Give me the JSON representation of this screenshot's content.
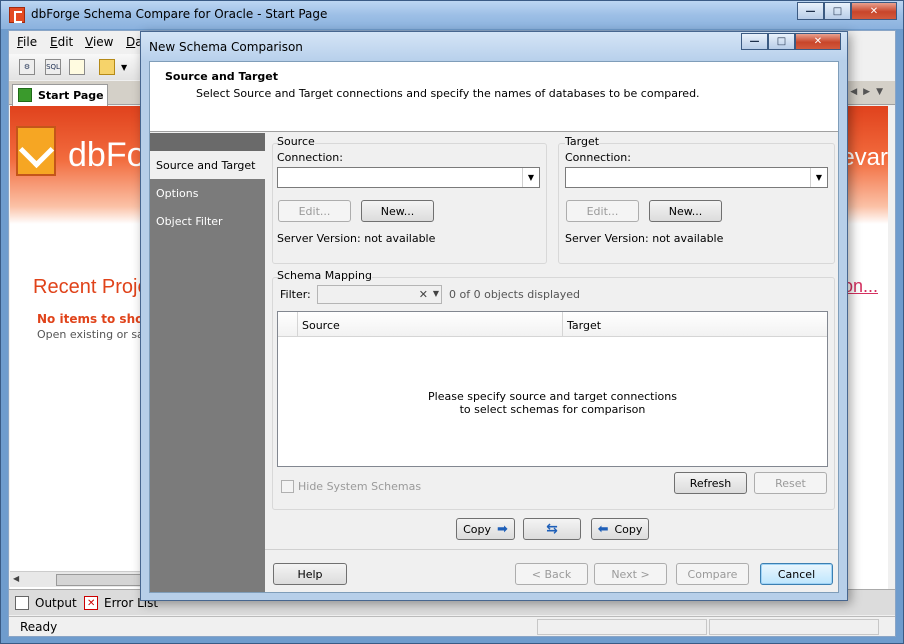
{
  "main_window": {
    "title": "dbForge Schema Compare for Oracle - Start Page",
    "menu": [
      {
        "label": "File",
        "hotkey": "F",
        "rest": "ile"
      },
      {
        "label": "Edit",
        "hotkey": "E",
        "rest": "dit"
      },
      {
        "label": "View",
        "hotkey": "V",
        "rest": "iew"
      },
      {
        "label": "Da",
        "hotkey": "D",
        "rest": "a"
      }
    ],
    "toolbar_icons": [
      "schema-compare-icon",
      "sql-icon",
      "new-document-icon",
      "open-folder-icon"
    ],
    "toolbar_sql_text": "SQL",
    "start_tab_label": "Start Page",
    "start_page": {
      "logo_text": "dbFor",
      "banner_right_text": "evar",
      "recent_projects_title": "Recent Proje",
      "no_items_text": "No items to show",
      "open_existing_text": "Open existing or sav",
      "comparison_link": "son..."
    },
    "bottom_tabs": {
      "output": "Output",
      "error_list": "Error List"
    },
    "status_text": "Ready"
  },
  "dialog": {
    "title": "New Schema Comparison",
    "header_title": "Source and Target",
    "header_subtitle": "Select Source and Target connections and specify the names of databases to be compared.",
    "nav_items": [
      "Source and Target",
      "Options",
      "Object Filter"
    ],
    "active_nav_index": 0,
    "source": {
      "group_label": "Source",
      "connection_label": "Connection:",
      "connection_value": "",
      "edit_label": "Edit...",
      "new_label": "New...",
      "server_version": "Server Version: not available"
    },
    "target": {
      "group_label": "Target",
      "connection_label": "Connection:",
      "connection_value": "",
      "edit_label": "Edit...",
      "new_label": "New...",
      "server_version": "Server Version: not available"
    },
    "schema_mapping": {
      "group_label": "Schema Mapping",
      "filter_label": "Filter:",
      "filter_value": "",
      "objects_displayed": "0 of 0 objects displayed",
      "columns": [
        "Source",
        "Target"
      ],
      "empty_message_line1": "Please specify source and target connections",
      "empty_message_line2": "to select schemas for comparison",
      "hide_system_schemas_label": "Hide System Schemas",
      "hide_system_schemas_checked": false,
      "refresh_label": "Refresh",
      "reset_label": "Reset"
    },
    "copy_right_label": "Copy",
    "copy_left_label": "Copy",
    "footer": {
      "help": "Help",
      "back": "< Back",
      "next": "Next >",
      "compare": "Compare",
      "cancel": "Cancel"
    }
  }
}
